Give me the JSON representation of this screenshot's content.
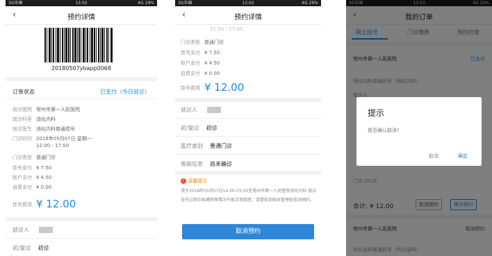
{
  "colors": {
    "accent": "#1e8be0",
    "button": "#2d86d8",
    "status_bar": "#1c1c1c"
  },
  "screen1": {
    "status": {
      "left": "3G中国",
      "center": "13:02",
      "right": "4G 29%"
    },
    "back_icon": "chevron-left-icon",
    "title": "预约详情",
    "barcode_number": "20180507ybapp0068",
    "order_status_label": "订单状态",
    "order_status_value": "已支付（今日就诊）",
    "rows": [
      {
        "k": "就诊医院",
        "v": "常州市第一人民医院"
      },
      {
        "k": "就诊科室",
        "v": "消化内科"
      },
      {
        "k": "就诊医生",
        "v": "消化内科普通挂号"
      },
      {
        "k": "门诊时间",
        "v": "2018年05月07日  星期一"
      },
      {
        "k": "",
        "v": "12:00 - 17:00"
      },
      {
        "k": "门诊类型",
        "v": "普通门诊"
      },
      {
        "k": "挂号支付",
        "v": "¥ 7.50"
      },
      {
        "k": "账户支付",
        "v": "¥ 4.50"
      },
      {
        "k": "自费支付",
        "v": "¥ 0.00"
      }
    ],
    "total": {
      "k": "挂号费用",
      "v": "¥ 12.00"
    },
    "patient_label": "就诊人",
    "visit_label": "初/复诊",
    "visit_value": "初诊"
  },
  "screen2": {
    "status": {
      "left": "3G中国",
      "center": "13:02",
      "right": "4G 29%"
    },
    "back_icon": "chevron-left-icon",
    "title": "预约详情",
    "partial_top": "12:00 - 17:00",
    "rows": [
      {
        "k": "门诊类型",
        "v": "普通门诊"
      },
      {
        "k": "挂号支付",
        "v": "¥ 7.50"
      },
      {
        "k": "账户支付",
        "v": "¥ 4.50"
      },
      {
        "k": "自费支付",
        "v": "¥ 0.00"
      }
    ],
    "total": {
      "k": "挂号费用",
      "v": "¥ 12.00"
    },
    "fields": [
      {
        "k": "就诊人",
        "v": ""
      },
      {
        "k": "初/复诊",
        "v": "初诊"
      },
      {
        "k": "医疗类别",
        "v": "普通门诊"
      },
      {
        "k": "疾病信息",
        "v": "尚未确诊"
      }
    ],
    "notice_title": "温馨提示",
    "notice_line1": "请于2018年05月07日14:00-15:00至常州市第一人民医院消化内科 就诊",
    "notice_line2": "挂号过程中如遇特殊情况不能正常就医，请提前到相关管理处取消预约。",
    "cancel_button": "取消预约"
  },
  "screen3": {
    "status": {
      "left": "3G中国",
      "center": "13:03",
      "right": "4G 29%"
    },
    "back_icon": "chevron-left-icon",
    "title": "我的订单",
    "tabs": [
      "网上挂号",
      "门诊缴费",
      "预约检查"
    ],
    "bg_hospital": "常州市第一人民医院",
    "bg_status": "已支付",
    "bg_dept": "消化内科普通挂号（消化内科）",
    "bg_patient": "就诊人",
    "bg_clinic": "门诊 2018",
    "bg_total": "合计: ¥ 12.00",
    "bg_btn1": "取消预约",
    "bg_btn2": "再次预约",
    "bg_hospital2": "常州市第一人民医院",
    "bg_status2": "取消预约",
    "bg_dept2": "内分泌科普通挂号（内分泌科）",
    "dialog_title": "提示",
    "dialog_message": "是否确认取消?",
    "dialog_cancel": "取消",
    "dialog_ok": "确定"
  }
}
